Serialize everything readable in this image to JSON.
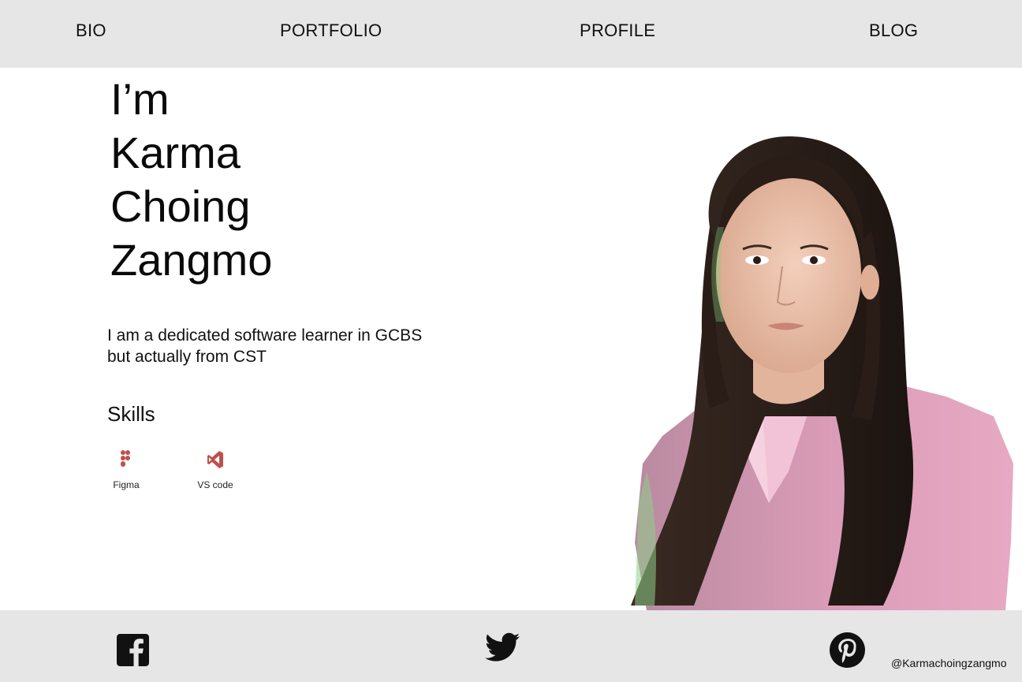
{
  "nav": {
    "bio": "BIO",
    "portfolio": "PORTFOLIO",
    "profile": "PROFILE",
    "blog": "BLOG"
  },
  "hero": {
    "line1": "I’m",
    "line2": "Karma",
    "line3": "Choing",
    "line4": "Zangmo"
  },
  "intro": {
    "text": "I am a dedicated software learner in GCBS but actually from CST"
  },
  "skills": {
    "title": "Skills",
    "items": [
      {
        "label": "Figma",
        "icon": "figma-icon"
      },
      {
        "label": "VS code",
        "icon": "vscode-icon"
      }
    ]
  },
  "footer": {
    "icons": [
      "facebook-icon",
      "twitter-icon",
      "pinterest-icon"
    ],
    "handle": "@Karmachoingzangmo"
  },
  "colors": {
    "bar_bg": "#e6e6e6",
    "accent_icon": "#c0504d",
    "text": "#111111"
  }
}
